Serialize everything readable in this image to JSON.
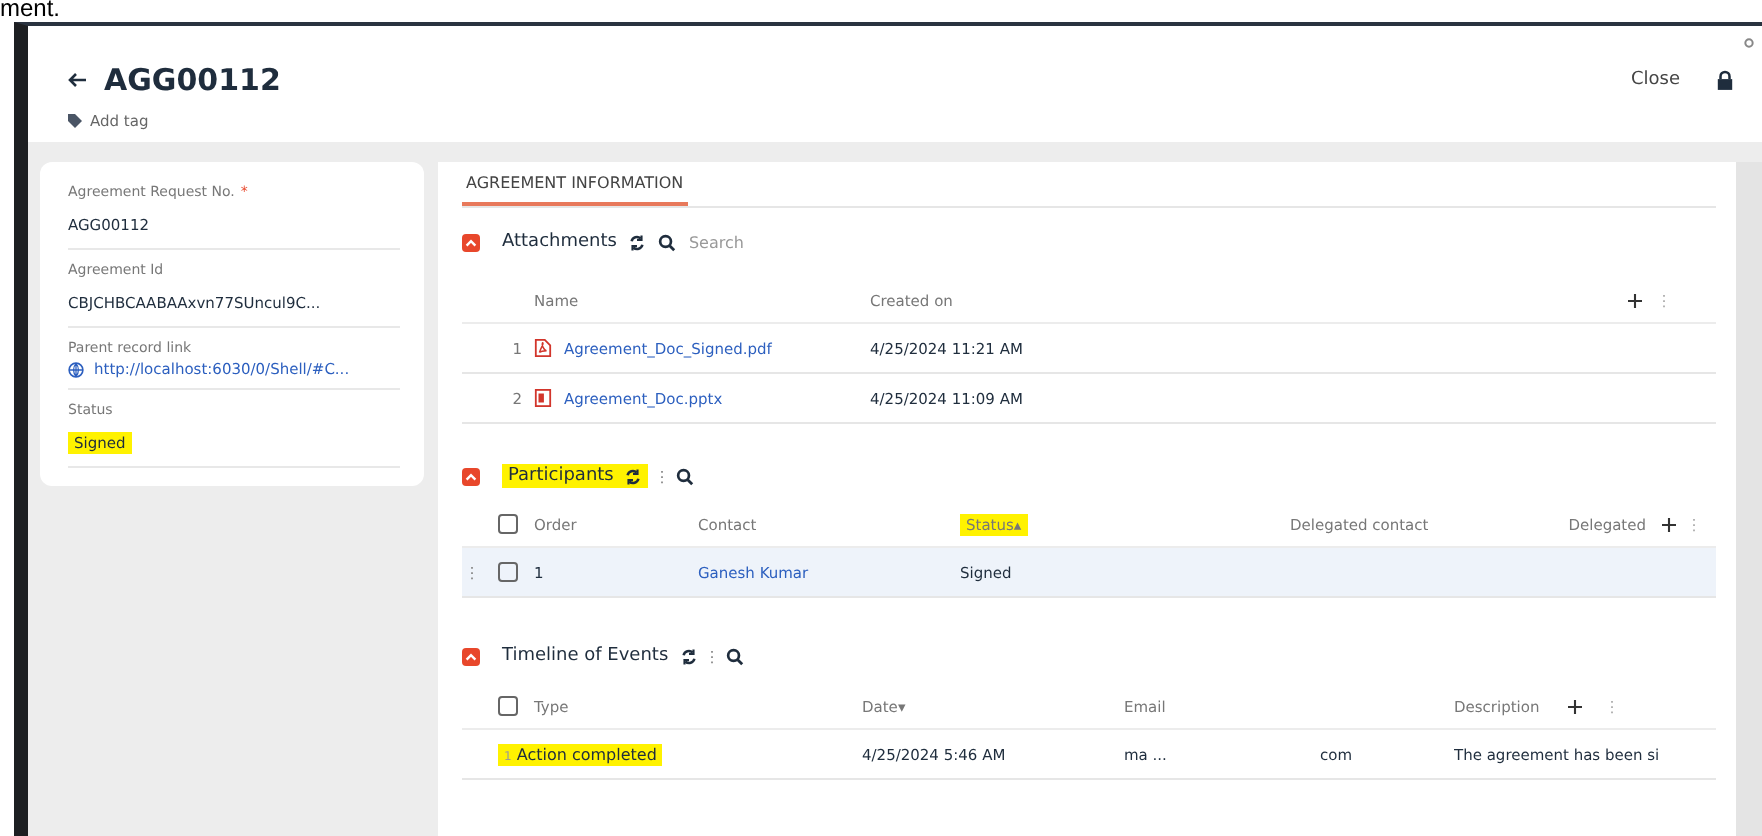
{
  "doc_fragment": "ment.",
  "header": {
    "title": "AGG00112",
    "add_tag": "Add tag",
    "close": "Close"
  },
  "record_fields": [
    {
      "label": "Agreement Request No.",
      "required_mark": "*",
      "value": "AGG00112",
      "kind": "text",
      "highlighted": false
    },
    {
      "label": "Agreement Id",
      "value": "CBJCHBCAABAAxvn77SUncul9C...",
      "kind": "text",
      "highlighted": false
    },
    {
      "label": "Parent record link",
      "value": "http://localhost:6030/0/Shell/#C...",
      "kind": "link",
      "highlighted": false
    },
    {
      "label": "Status",
      "value": "Signed",
      "kind": "text",
      "highlighted": true
    }
  ],
  "tabs": [
    {
      "label": "AGREEMENT INFORMATION",
      "selected": true
    }
  ],
  "attachments": {
    "title": "Attachments",
    "search_placeholder": "Search",
    "columns": [
      "Name",
      "Created on"
    ],
    "rows": [
      {
        "index": "1",
        "name": "Agreement_Doc_Signed.pdf",
        "kind": "pdf",
        "created_on": "4/25/2024 11:21 AM"
      },
      {
        "index": "2",
        "name": "Agreement_Doc.pptx",
        "kind": "presentation",
        "created_on": "4/25/2024 11:09 AM"
      }
    ]
  },
  "participants": {
    "title": "Participants",
    "highlighted": true,
    "all_checked": false,
    "columns": [
      {
        "label": "Order",
        "highlighted": false
      },
      {
        "label": "Contact",
        "highlighted": false
      },
      {
        "label": "Status",
        "sort_mark": "▴",
        "highlighted": true
      },
      {
        "label": "Delegated contact",
        "highlighted": false
      },
      {
        "label": "Delegated",
        "highlighted": false
      }
    ],
    "rows": [
      {
        "order": "1",
        "contact": "Ganesh Kumar",
        "status": "Signed",
        "checked": false,
        "selected": true
      }
    ]
  },
  "timeline": {
    "title": "Timeline of Events",
    "highlighted": false,
    "all_checked": false,
    "columns": [
      {
        "label": "Type"
      },
      {
        "label": "Date",
        "sort_mark": "▾"
      },
      {
        "label": "Email"
      },
      {
        "label": "Description"
      }
    ],
    "rows": [
      {
        "index": "1",
        "type": "Action completed",
        "highlighted": true,
        "date": "4/25/2024 5:46 AM",
        "email": "ma ...",
        "email_domain": "com",
        "description": "The agreement has been si"
      }
    ]
  }
}
